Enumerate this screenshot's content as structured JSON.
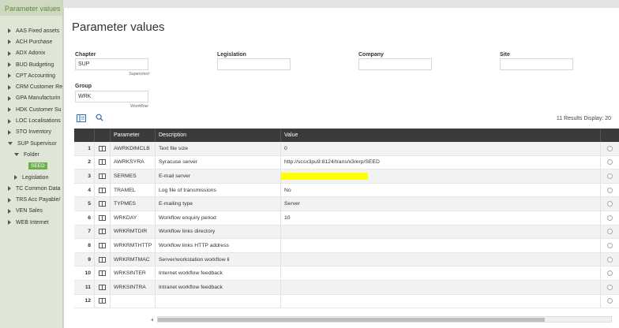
{
  "sidebar": {
    "title": "Parameter values",
    "items": [
      {
        "label": "AAS Fixed assets",
        "level": 0
      },
      {
        "label": "ACH Purchase",
        "level": 0
      },
      {
        "label": "ADX Adonix",
        "level": 0
      },
      {
        "label": "BUD Budgeting",
        "level": 0
      },
      {
        "label": "CPT Accounting",
        "level": 0
      },
      {
        "label": "CRM Customer Re",
        "level": 0
      },
      {
        "label": "GPA Manufacturin",
        "level": 0
      },
      {
        "label": "HDK Customer Su",
        "level": 0
      },
      {
        "label": "LOC Localisations",
        "level": 0
      },
      {
        "label": "STO Inventory",
        "level": 0
      },
      {
        "label": "SUP Supervisor",
        "level": 0,
        "expanded": true
      },
      {
        "label": "Folder",
        "level": 1,
        "expanded": true
      },
      {
        "label": "SEED",
        "level": 2,
        "selected": true
      },
      {
        "label": "Legislation",
        "level": 1
      },
      {
        "label": "TC Common Data",
        "level": 0
      },
      {
        "label": "TRS Acc Payable/",
        "level": 0
      },
      {
        "label": "VEN Sales",
        "level": 0
      },
      {
        "label": "WEB Internet",
        "level": 0
      }
    ]
  },
  "main": {
    "title": "Parameter values",
    "fields": {
      "chapter": {
        "label": "Chapter",
        "value": "SUP",
        "sub": "Supervisor"
      },
      "legislation": {
        "label": "Legislation",
        "value": ""
      },
      "company": {
        "label": "Company",
        "value": ""
      },
      "site": {
        "label": "Site",
        "value": ""
      },
      "group": {
        "label": "Group",
        "value": "WRK",
        "sub": "Workflow"
      }
    },
    "results_text": "11 Results  Display:  20"
  },
  "table": {
    "columns": [
      "",
      "",
      "Parameter",
      "Description",
      "Value"
    ],
    "rows": [
      {
        "num": "1",
        "param": "AWRKDIMCLB",
        "desc": "Text file size",
        "value": "0"
      },
      {
        "num": "2",
        "param": "AWRKSYRA",
        "desc": "Syracuse server",
        "value": "http://scsx3pu9:8124/trans/x3/erp/SEED"
      },
      {
        "num": "3",
        "param": "SERMES",
        "desc": "E-mail server",
        "value": "",
        "highlight": true
      },
      {
        "num": "4",
        "param": "TRAMEL",
        "desc": "Log file of transmissions",
        "value": "No"
      },
      {
        "num": "5",
        "param": "TYPMES",
        "desc": "E-mailing type",
        "value": "Server"
      },
      {
        "num": "6",
        "param": "WRKDAY",
        "desc": "Workflow enquiry period",
        "value": "10"
      },
      {
        "num": "7",
        "param": "WRKRMTDIR",
        "desc": "Workflow links directory",
        "value": ""
      },
      {
        "num": "8",
        "param": "WRKRMTHTTP",
        "desc": "Workflow links HTTP address",
        "value": ""
      },
      {
        "num": "9",
        "param": "WRKRMTMAC",
        "desc": "Server/workstation workflow li",
        "value": ""
      },
      {
        "num": "10",
        "param": "WRKSINTER",
        "desc": "Internet workflow feedback",
        "value": ""
      },
      {
        "num": "11",
        "param": "WRKSINTRA",
        "desc": "Intranet workflow feedback",
        "value": ""
      },
      {
        "num": "12",
        "param": "",
        "desc": "",
        "value": ""
      }
    ]
  },
  "colors": {
    "accent_green": "#6ab04c",
    "header_dark": "#3b3b3b",
    "highlight": "#ffff00"
  }
}
